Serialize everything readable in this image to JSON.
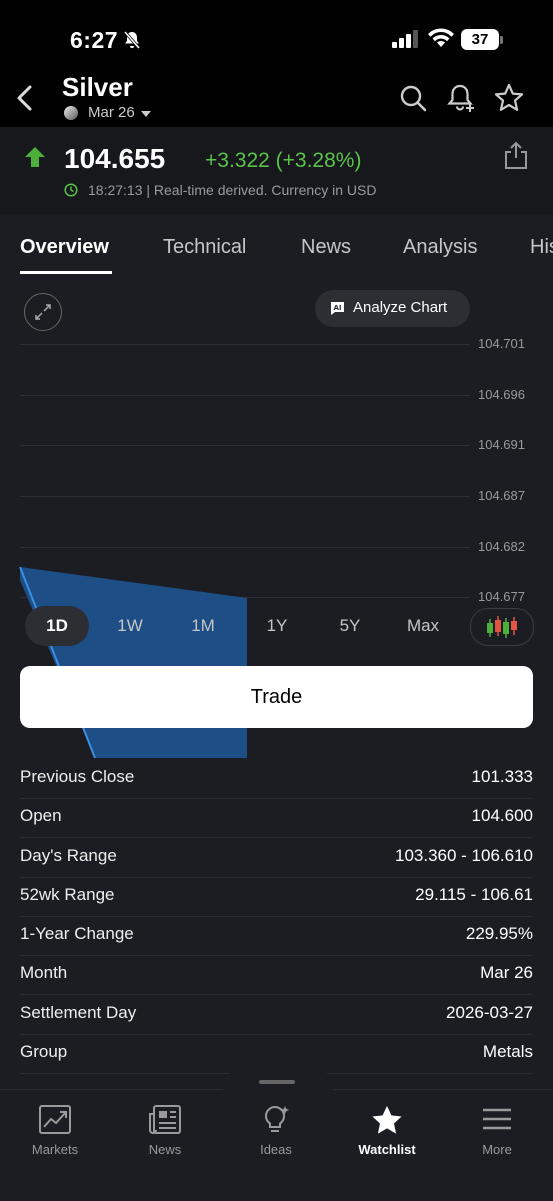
{
  "status": {
    "time": "6:27",
    "battery": "37"
  },
  "header": {
    "title": "Silver",
    "contract": "Mar 26"
  },
  "quote": {
    "price": "104.655",
    "change": "+3.322 (+3.28%)",
    "note": "18:27:13 | Real-time derived. Currency in USD",
    "up_color": "#5cc24a"
  },
  "tabs": [
    {
      "label": "Overview",
      "active": true
    },
    {
      "label": "Technical"
    },
    {
      "label": "News"
    },
    {
      "label": "Analysis"
    },
    {
      "label": "His"
    }
  ],
  "chart": {
    "analyze_label": "Analyze Chart",
    "analyze_badge": "AI",
    "y_ticks": [
      "104.701",
      "104.696",
      "104.691",
      "104.687",
      "104.682",
      "104.677"
    ],
    "ranges": [
      "1D",
      "1W",
      "1M",
      "1Y",
      "5Y",
      "Max"
    ],
    "selected_range": "1D",
    "area_color": "#1d4f86"
  },
  "trade_label": "Trade",
  "stats": [
    {
      "label": "Previous Close",
      "value": "101.333"
    },
    {
      "label": "Open",
      "value": "104.600"
    },
    {
      "label": "Day's Range",
      "value": "103.360 - 106.610"
    },
    {
      "label": "52wk Range",
      "value": "29.115 - 106.61"
    },
    {
      "label": "1-Year Change",
      "value": "229.95%"
    },
    {
      "label": "Month",
      "value": "Mar 26"
    },
    {
      "label": "Settlement Day",
      "value": "2026-03-27"
    },
    {
      "label": "Group",
      "value": "Metals"
    }
  ],
  "nav": [
    {
      "label": "Markets",
      "icon": "markets-icon"
    },
    {
      "label": "News",
      "icon": "news-icon"
    },
    {
      "label": "Ideas",
      "icon": "ideas-icon"
    },
    {
      "label": "Watchlist",
      "icon": "star-icon",
      "active": true
    },
    {
      "label": "More",
      "icon": "menu-icon"
    }
  ]
}
